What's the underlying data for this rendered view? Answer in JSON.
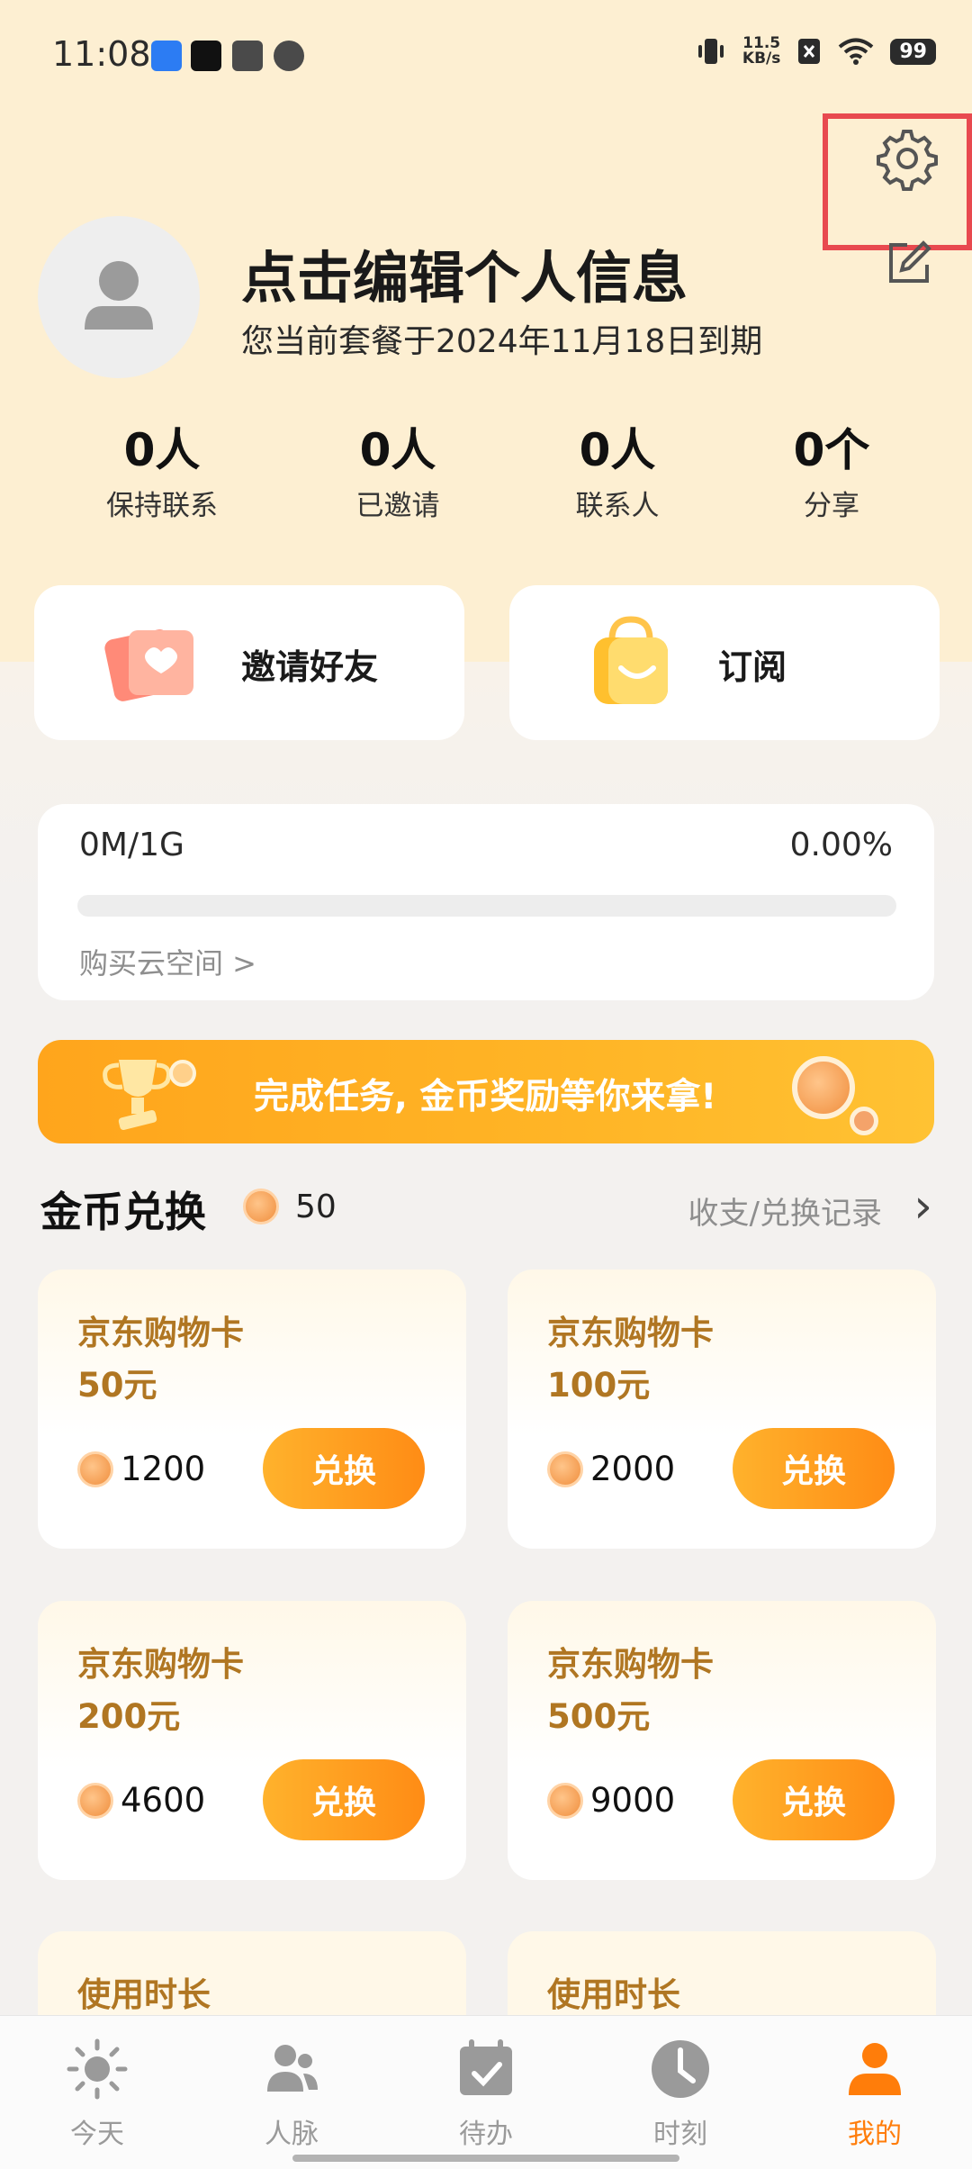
{
  "status_bar": {
    "time": "11:08",
    "net_speed": "11.5",
    "net_unit": "KB/s",
    "battery": "99",
    "app_icon_colors": [
      "#2c7cf3",
      "#111111",
      "#4a4a4a",
      "#4a4a4a"
    ]
  },
  "profile": {
    "name": "点击编辑个人信息",
    "plan_text": "您当前套餐于2024年11月18日到期"
  },
  "stats": [
    {
      "value": "0人",
      "label": "保持联系"
    },
    {
      "value": "0人",
      "label": "已邀请"
    },
    {
      "value": "0人",
      "label": "联系人"
    },
    {
      "value": "0个",
      "label": "分享"
    }
  ],
  "quick_actions": {
    "invite": "邀请好友",
    "subscribe": "订阅"
  },
  "storage": {
    "used": "0M/1G",
    "percent_text": "0.00%",
    "fill_fraction": 0,
    "buy_link": "购买云空间 >"
  },
  "banner": {
    "text": "完成任务, 金币奖励等你来拿!"
  },
  "coins": {
    "title": "金币兑换",
    "balance": "50",
    "record_link": "收支/兑换记录"
  },
  "gifts": [
    {
      "title": "京东购物卡",
      "amount": "50元",
      "price": "1200",
      "button": "兑换"
    },
    {
      "title": "京东购物卡",
      "amount": "100元",
      "price": "2000",
      "button": "兑换"
    },
    {
      "title": "京东购物卡",
      "amount": "200元",
      "price": "4600",
      "button": "兑换"
    },
    {
      "title": "京东购物卡",
      "amount": "500元",
      "price": "9000",
      "button": "兑换"
    }
  ],
  "partial_cards": [
    {
      "title": "使用时长"
    },
    {
      "title": "使用时长"
    }
  ],
  "nav": [
    {
      "label": "今天",
      "icon": "sun-icon"
    },
    {
      "label": "人脉",
      "icon": "people-icon"
    },
    {
      "label": "待办",
      "icon": "calendar-check-icon"
    },
    {
      "label": "时刻",
      "icon": "clock-icon"
    },
    {
      "label": "我的",
      "icon": "person-icon",
      "active": true
    }
  ],
  "colors": {
    "accent": "#ff7d0a",
    "header_bg": "#fdefd2",
    "gift_title": "#b07622",
    "highlight": "#e8494f"
  }
}
